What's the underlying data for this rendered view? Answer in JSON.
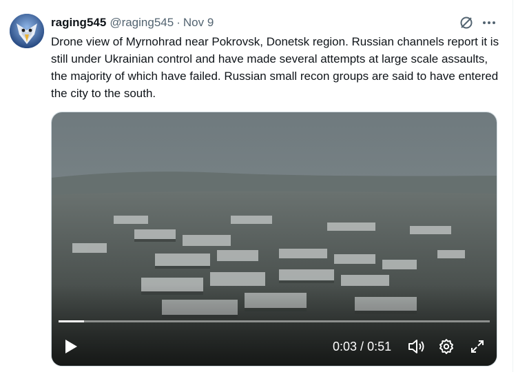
{
  "tweet": {
    "author_name": "raging545",
    "handle": "@raging545",
    "separator": "·",
    "date": "Nov 9",
    "text": "Drone view of Myrnohrad near Pokrovsk, Donetsk region. Russian channels report it is still under Ukrainian control and have made several attempts at large scale assaults, the majority of which have failed. Russian small recon groups are said to have entered the city to the south."
  },
  "icons": {
    "header": [
      "grok-icon",
      "more-icon"
    ],
    "player": [
      "play-icon",
      "volume-icon",
      "settings-icon",
      "fullscreen-icon"
    ]
  },
  "video": {
    "current_time": "0:03",
    "time_separator": " / ",
    "duration": "0:51",
    "progress_fraction": 0.059
  },
  "colors": {
    "text_primary": "#0f1419",
    "text_secondary": "#536471",
    "media_border": "#cfd9de"
  }
}
